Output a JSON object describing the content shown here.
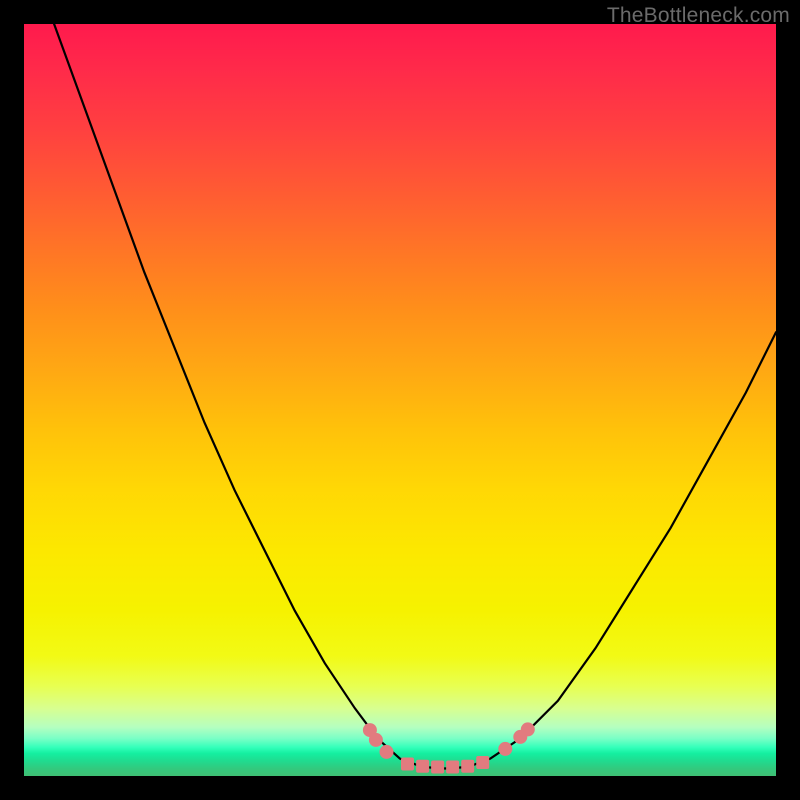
{
  "watermark": "TheBottleneck.com",
  "chart_data": {
    "type": "line",
    "title": "",
    "xlabel": "",
    "ylabel": "",
    "xlim": [
      0,
      100
    ],
    "ylim": [
      0,
      100
    ],
    "grid": false,
    "series": [
      {
        "name": "curve",
        "color": "#000000",
        "x": [
          4,
          8,
          12,
          16,
          20,
          24,
          28,
          32,
          36,
          40,
          44,
          47,
          50,
          53,
          56,
          59,
          62,
          66,
          71,
          76,
          81,
          86,
          91,
          96,
          100
        ],
        "y": [
          100,
          89,
          78,
          67,
          57,
          47,
          38,
          30,
          22,
          15,
          9,
          5,
          2.3,
          1.2,
          1.0,
          1.2,
          2.3,
          5,
          10,
          17,
          25,
          33,
          42,
          51,
          59
        ]
      }
    ],
    "markers": [
      {
        "name": "marker",
        "shape": "circle",
        "color": "#e27b7f",
        "x": 46.0,
        "y": 6.1
      },
      {
        "name": "marker",
        "shape": "circle",
        "color": "#e27b7f",
        "x": 46.8,
        "y": 4.8
      },
      {
        "name": "marker",
        "shape": "circle",
        "color": "#e27b7f",
        "x": 48.2,
        "y": 3.2
      },
      {
        "name": "marker",
        "shape": "square",
        "color": "#e27b7f",
        "x": 51.0,
        "y": 1.6
      },
      {
        "name": "marker",
        "shape": "square",
        "color": "#e27b7f",
        "x": 53.0,
        "y": 1.3
      },
      {
        "name": "marker",
        "shape": "square",
        "color": "#e27b7f",
        "x": 55.0,
        "y": 1.2
      },
      {
        "name": "marker",
        "shape": "square",
        "color": "#e27b7f",
        "x": 57.0,
        "y": 1.2
      },
      {
        "name": "marker",
        "shape": "square",
        "color": "#e27b7f",
        "x": 59.0,
        "y": 1.3
      },
      {
        "name": "marker",
        "shape": "square",
        "color": "#e27b7f",
        "x": 61.0,
        "y": 1.8
      },
      {
        "name": "marker",
        "shape": "circle",
        "color": "#e27b7f",
        "x": 64.0,
        "y": 3.6
      },
      {
        "name": "marker",
        "shape": "circle",
        "color": "#e27b7f",
        "x": 66.0,
        "y": 5.2
      },
      {
        "name": "marker",
        "shape": "circle",
        "color": "#e27b7f",
        "x": 67.0,
        "y": 6.2
      }
    ],
    "gradient_stops": [
      {
        "pos": 0,
        "color": "#ff1a4d"
      },
      {
        "pos": 50,
        "color": "#ffc20a"
      },
      {
        "pos": 80,
        "color": "#f6f200"
      },
      {
        "pos": 96,
        "color": "#33ffba"
      },
      {
        "pos": 100,
        "color": "#3fbf74"
      }
    ]
  }
}
